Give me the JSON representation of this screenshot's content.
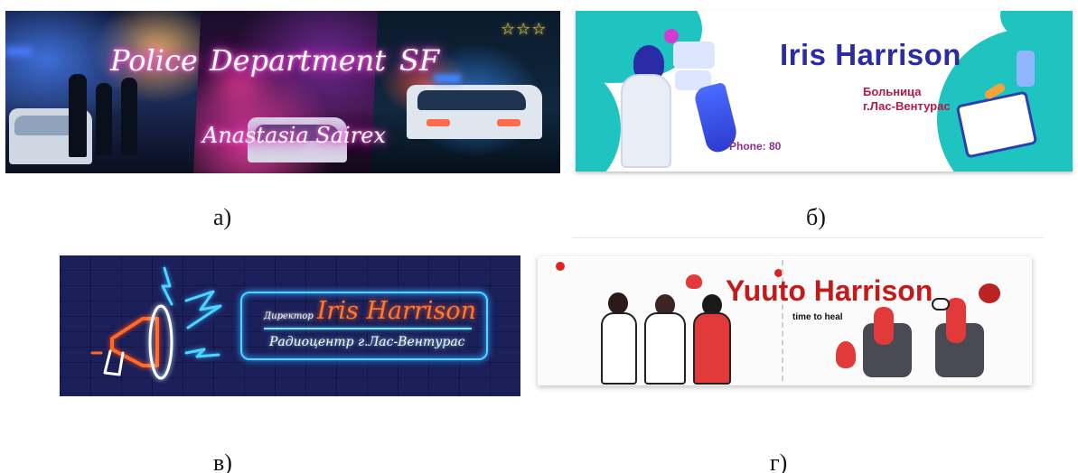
{
  "banners": {
    "a": {
      "caption": "а)",
      "line1_word1": "Police",
      "line1_word2": "Department",
      "line1_word3": "SF",
      "name": "Anastasia Sairex",
      "stars": "☆☆☆"
    },
    "b": {
      "caption": "б)",
      "name": "Iris Harrison",
      "hospital_line1": "Больница",
      "hospital_line2": "г.Лас-Вентурас",
      "phone": "Phone: 80"
    },
    "v": {
      "caption": "в)",
      "director": "Директор",
      "name": "Iris Harrison",
      "subtitle": "Радиоцентр г.Лас-Вентурас"
    },
    "g": {
      "caption": "г)",
      "name": "Yuuto Harrison",
      "tagline": "time to heal"
    }
  },
  "colors": {
    "b_name": "#2a2ba5",
    "b_hospital": "#b31a45",
    "b_teal": "#1fc4c0",
    "v_background": "#1b1f5a",
    "v_orange": "#ff7a2c",
    "v_cyan": "#4fd6ff",
    "g_red": "#c41a1a"
  }
}
